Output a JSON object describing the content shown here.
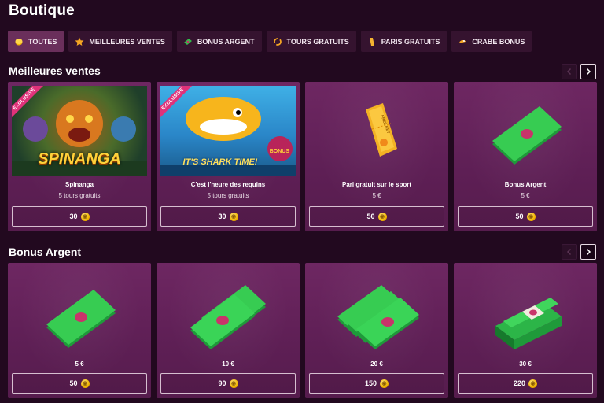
{
  "page": {
    "title": "Boutique"
  },
  "filters": [
    {
      "label": "TOUTES",
      "icon": "coin-icon",
      "active": true
    },
    {
      "label": "MEILLEURES VENTES",
      "icon": "star-icon"
    },
    {
      "label": "BONUS ARGENT",
      "icon": "money-icon"
    },
    {
      "label": "TOURS GRATUITS",
      "icon": "spin-icon"
    },
    {
      "label": "PARIS GRATUITS",
      "icon": "ticket-icon"
    },
    {
      "label": "CRABE BONUS",
      "icon": "crab-icon"
    }
  ],
  "sections": [
    {
      "title": "Meilleures ventes",
      "cards": [
        {
          "name": "Spinanga",
          "sub": "5 tours gratuits",
          "price": "30",
          "badge": "EXCLUSIVE",
          "art_title": "SPINANGA"
        },
        {
          "name": "C'est l'heure des requins",
          "sub": "5 tours gratuits",
          "price": "30",
          "badge": "EXCLUSIVE",
          "art_title": "IT'S SHARK TIME!",
          "art_badge": "BONUS"
        },
        {
          "name": "Pari gratuit sur le sport",
          "sub": "5 €",
          "price": "50",
          "art_label": "FREE BET"
        },
        {
          "name": "Bonus Argent",
          "sub": "5 €",
          "price": "50"
        }
      ]
    },
    {
      "title": "Bonus Argent",
      "cards": [
        {
          "name": "5 €",
          "price": "50"
        },
        {
          "name": "10 €",
          "price": "90"
        },
        {
          "name": "20 €",
          "price": "150"
        },
        {
          "name": "30 €",
          "price": "220"
        }
      ]
    }
  ],
  "colors": {
    "background": "#22091f",
    "card": "#6e2762",
    "chip": "#35132f",
    "chip_active": "#6a2f5b",
    "coin": "#f0b400",
    "ribbon": "#e0327a"
  }
}
